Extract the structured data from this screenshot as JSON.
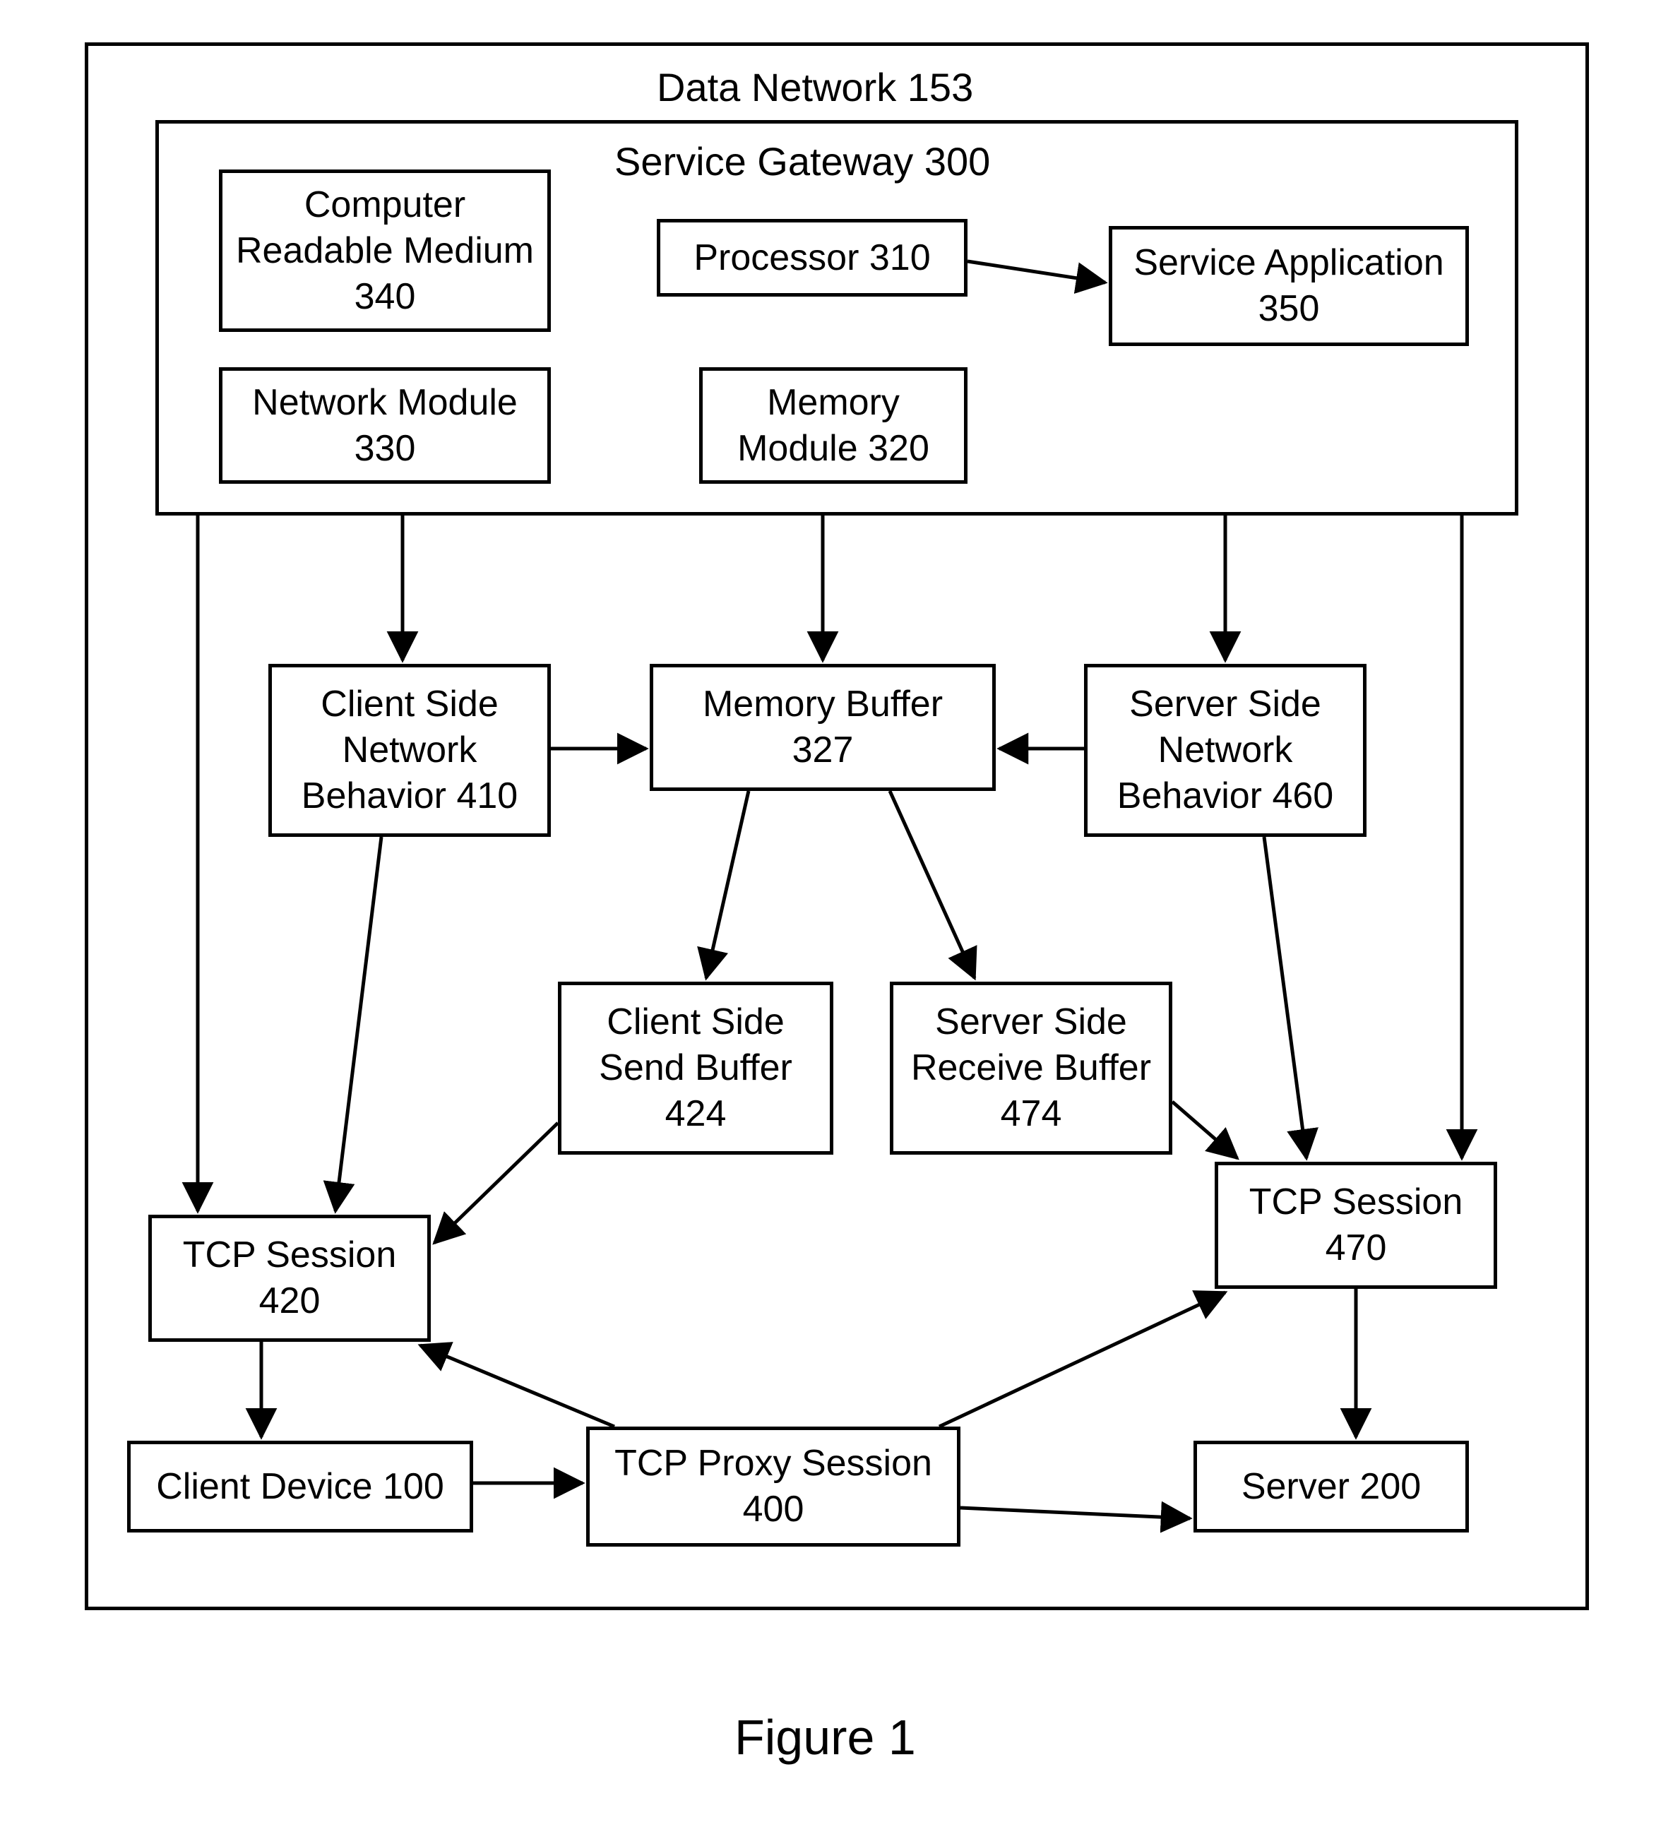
{
  "figure_label": "Figure 1",
  "outer_frame": {
    "title": "Data Network 153"
  },
  "inner_frame": {
    "title": "Service Gateway 300"
  },
  "nodes": {
    "crm": {
      "l1": "Computer",
      "l2": "Readable Medium",
      "l3": "340"
    },
    "processor": {
      "l1": "Processor 310"
    },
    "service_app": {
      "l1": "Service Application",
      "l2": "350"
    },
    "net_module": {
      "l1": "Network Module",
      "l2": "330"
    },
    "mem_module": {
      "l1": "Memory",
      "l2": "Module 320"
    },
    "mem_buffer": {
      "l1": "Memory Buffer",
      "l2": "327"
    },
    "client_behavior": {
      "l1": "Client Side",
      "l2": "Network",
      "l3": "Behavior 410"
    },
    "server_behavior": {
      "l1": "Server Side",
      "l2": "Network",
      "l3": "Behavior 460"
    },
    "client_send_buf": {
      "l1": "Client Side",
      "l2": "Send Buffer",
      "l3": "424"
    },
    "server_recv_buf": {
      "l1": "Server Side",
      "l2": "Receive Buffer",
      "l3": "474"
    },
    "tcp_420": {
      "l1": "TCP Session",
      "l2": "420"
    },
    "tcp_470": {
      "l1": "TCP Session",
      "l2": "470"
    },
    "tcp_proxy": {
      "l1": "TCP Proxy Session",
      "l2": "400"
    },
    "client_device": {
      "l1": "Client Device 100"
    },
    "server": {
      "l1": "Server 200"
    }
  },
  "chart_data": {
    "type": "diagram",
    "title": "Figure 1 — Data Network 153 / Service Gateway 300 block diagram",
    "containers": [
      {
        "id": "data_network_153",
        "label": "Data Network 153",
        "children": [
          "service_gateway_300",
          "memory_buffer_327",
          "client_behavior_410",
          "server_behavior_460",
          "client_send_buf_424",
          "server_recv_buf_474",
          "tcp_session_420",
          "tcp_session_470",
          "tcp_proxy_400",
          "client_device_100",
          "server_200"
        ]
      },
      {
        "id": "service_gateway_300",
        "label": "Service Gateway 300",
        "children": [
          "crm_340",
          "processor_310",
          "service_app_350",
          "net_module_330",
          "mem_module_320"
        ]
      }
    ],
    "nodes": [
      {
        "id": "crm_340",
        "label": "Computer Readable Medium 340"
      },
      {
        "id": "processor_310",
        "label": "Processor 310"
      },
      {
        "id": "service_app_350",
        "label": "Service Application 350"
      },
      {
        "id": "net_module_330",
        "label": "Network Module 330"
      },
      {
        "id": "mem_module_320",
        "label": "Memory Module 320"
      },
      {
        "id": "memory_buffer_327",
        "label": "Memory Buffer 327"
      },
      {
        "id": "client_behavior_410",
        "label": "Client Side Network Behavior 410"
      },
      {
        "id": "server_behavior_460",
        "label": "Server Side Network Behavior 460"
      },
      {
        "id": "client_send_buf_424",
        "label": "Client Side Send Buffer 424"
      },
      {
        "id": "server_recv_buf_474",
        "label": "Server Side Receive Buffer 474"
      },
      {
        "id": "tcp_session_420",
        "label": "TCP Session 420"
      },
      {
        "id": "tcp_session_470",
        "label": "TCP Session 470"
      },
      {
        "id": "tcp_proxy_400",
        "label": "TCP Proxy Session 400"
      },
      {
        "id": "client_device_100",
        "label": "Client Device 100"
      },
      {
        "id": "server_200",
        "label": "Server 200"
      }
    ],
    "edges": [
      {
        "from": "processor_310",
        "to": "service_app_350"
      },
      {
        "from": "service_gateway_300",
        "to": "memory_buffer_327",
        "via": "mem_module_320"
      },
      {
        "from": "service_gateway_300",
        "to": "client_behavior_410"
      },
      {
        "from": "service_gateway_300",
        "to": "server_behavior_460"
      },
      {
        "from": "service_gateway_300",
        "to": "tcp_session_420"
      },
      {
        "from": "service_gateway_300",
        "to": "tcp_session_470"
      },
      {
        "from": "client_behavior_410",
        "to": "memory_buffer_327"
      },
      {
        "from": "server_behavior_460",
        "to": "memory_buffer_327"
      },
      {
        "from": "client_behavior_410",
        "to": "tcp_session_420"
      },
      {
        "from": "server_behavior_460",
        "to": "tcp_session_470"
      },
      {
        "from": "memory_buffer_327",
        "to": "client_send_buf_424"
      },
      {
        "from": "memory_buffer_327",
        "to": "server_recv_buf_474"
      },
      {
        "from": "client_send_buf_424",
        "to": "tcp_session_420"
      },
      {
        "from": "server_recv_buf_474",
        "to": "tcp_session_470"
      },
      {
        "from": "tcp_session_420",
        "to": "client_device_100"
      },
      {
        "from": "tcp_session_470",
        "to": "server_200"
      },
      {
        "from": "client_device_100",
        "to": "tcp_proxy_400"
      },
      {
        "from": "tcp_proxy_400",
        "to": "tcp_session_420"
      },
      {
        "from": "tcp_proxy_400",
        "to": "tcp_session_470"
      },
      {
        "from": "tcp_proxy_400",
        "to": "server_200"
      }
    ]
  }
}
